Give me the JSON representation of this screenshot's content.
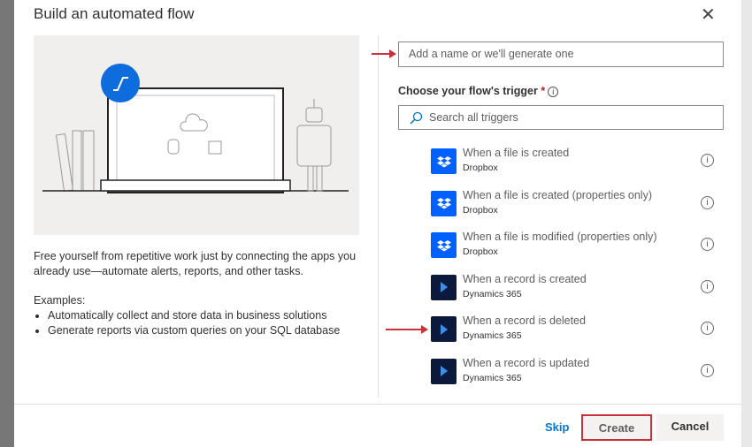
{
  "dialog": {
    "title": "Build an automated flow",
    "close_label": "✕"
  },
  "left": {
    "description": "Free yourself from repetitive work just by connecting the apps you already use—automate alerts, reports, and other tasks.",
    "examples_label": "Examples:",
    "examples": [
      "Automatically collect and store data in business solutions",
      "Generate reports via custom queries on your SQL database"
    ]
  },
  "name_input": {
    "placeholder": "Add a name or we'll generate one"
  },
  "trigger": {
    "label": "Choose your flow's trigger",
    "required": "*",
    "info": "i",
    "search_placeholder": "Search all triggers"
  },
  "triggers": [
    {
      "title": "When a file is created",
      "connector": "Dropbox",
      "icon": "dropbox-icon",
      "color": "#0061fe"
    },
    {
      "title": "When a file is created (properties only)",
      "connector": "Dropbox",
      "icon": "dropbox-icon",
      "color": "#0061fe"
    },
    {
      "title": "When a file is modified (properties only)",
      "connector": "Dropbox",
      "icon": "dropbox-icon",
      "color": "#0061fe"
    },
    {
      "title": "When a record is created",
      "connector": "Dynamics 365",
      "icon": "dynamics-icon",
      "color": "#0b1a3c"
    },
    {
      "title": "When a record is deleted",
      "connector": "Dynamics 365",
      "icon": "dynamics-icon",
      "color": "#0b1a3c"
    },
    {
      "title": "When a record is updated",
      "connector": "Dynamics 365",
      "icon": "dynamics-icon",
      "color": "#0b1a3c"
    }
  ],
  "footer": {
    "skip": "Skip",
    "create": "Create",
    "cancel": "Cancel"
  }
}
